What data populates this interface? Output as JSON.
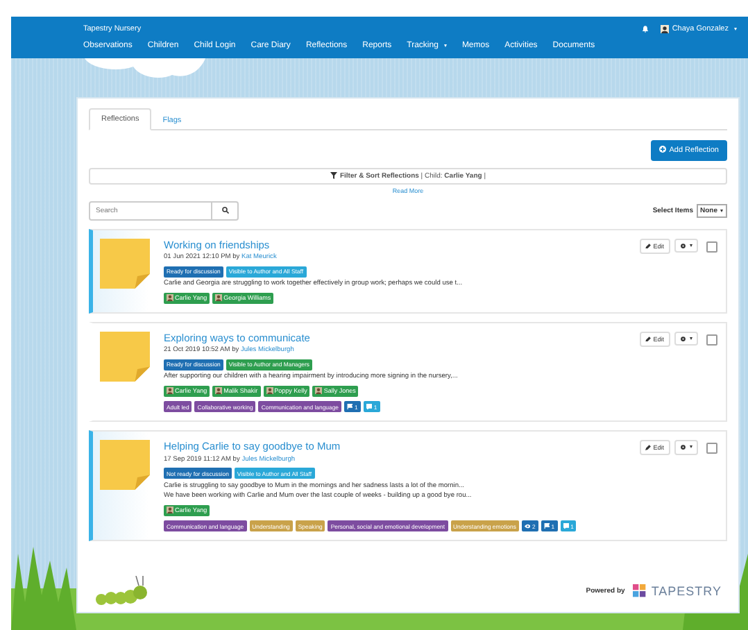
{
  "nav": {
    "brand": "Tapestry Nursery",
    "user": "Chaya Gonzalez",
    "items": [
      {
        "label": "Observations",
        "dropdown": false
      },
      {
        "label": "Children",
        "dropdown": false
      },
      {
        "label": "Child Login",
        "dropdown": false
      },
      {
        "label": "Care Diary",
        "dropdown": false
      },
      {
        "label": "Reflections",
        "dropdown": false
      },
      {
        "label": "Reports",
        "dropdown": false
      },
      {
        "label": "Tracking",
        "dropdown": true
      },
      {
        "label": "Memos",
        "dropdown": false
      },
      {
        "label": "Activities",
        "dropdown": false
      },
      {
        "label": "Documents",
        "dropdown": false
      }
    ]
  },
  "tabs": [
    {
      "label": "Reflections",
      "selected": true
    },
    {
      "label": "Flags",
      "selected": false
    }
  ],
  "add_button": "Add Reflection",
  "filter": "**Filter & Sort Reflections** | Child: **Carlie Yang** |",
  "read_more": "Read More",
  "search": {
    "placeholder": "Search"
  },
  "select_items": {
    "label": "Select Items",
    "value": "None"
  },
  "reflections": [
    {
      "title": "Working on friendships",
      "date": "01 Jun 2021 12:10 PM by",
      "author": "Kat Meurick",
      "highlighted": true,
      "statuses": [
        {
          "label": "Ready for discussion",
          "color": "#1f6fb2"
        },
        {
          "label": "Visible to Author and All Staff",
          "color": "#2aa8d8"
        }
      ],
      "excerpts": [
        "Carlie and Georgia are struggling to work together effectively in group work; perhaps we could use t..."
      ],
      "children": [
        "Carlie Yang",
        "Georgia Williams"
      ],
      "edit": "Edit"
    },
    {
      "title": "Exploring ways to communicate",
      "date": "21 Oct 2019 10:52 AM by",
      "author": "Jules Mickelburgh",
      "highlighted": false,
      "statuses": [
        {
          "label": "Ready for discussion",
          "color": "#1f6fb2"
        },
        {
          "label": "Visible to Author and Managers",
          "color": "#2e9e4f"
        }
      ],
      "excerpts": [
        "After supporting our children with a hearing impairment by introducing more signing in the nursery,..."
      ],
      "children": [
        "Carlie Yang",
        "Malik Shakir",
        "Poppy Kelly",
        "Sally Jones"
      ],
      "edit": "Edit",
      "tags": [
        {
          "label": "Adult led",
          "color": "#7d4ca0"
        },
        {
          "label": "Collaborative working",
          "color": "#7d4ca0"
        },
        {
          "label": "Communication and language",
          "color": "#7d4ca0"
        }
      ],
      "counters": [
        {
          "kind": "flag",
          "count": "1",
          "color": "#1f6fb2"
        },
        {
          "kind": "comment",
          "count": "1",
          "color": "#2aa8d8"
        }
      ]
    },
    {
      "title": "Helping Carlie to say goodbye to Mum",
      "date": "17 Sep 2019 11:12 AM by",
      "author": "Jules Mickelburgh",
      "highlighted": true,
      "statuses": [
        {
          "label": "Not ready for discussion",
          "color": "#1f6fb2"
        },
        {
          "label": "Visible to Author and All Staff",
          "color": "#2aa8d8"
        }
      ],
      "excerpts": [
        "Carlie is struggling to say goodbye to Mum in the mornings and her sadness lasts a lot of the mornin...",
        "We have been working with Carlie and Mum over the last couple of weeks - building up a good bye rou..."
      ],
      "children": [
        "Carlie Yang"
      ],
      "edit": "Edit",
      "tags": [
        {
          "label": "Communication and language",
          "color": "#7d4ca0"
        },
        {
          "label": "Understanding",
          "color": "#c9a24a"
        },
        {
          "label": "Speaking",
          "color": "#c9a24a"
        },
        {
          "label": "Personal, social and emotional development",
          "color": "#7d4ca0"
        },
        {
          "label": "Understanding emotions",
          "color": "#c9a24a"
        }
      ],
      "counters": [
        {
          "kind": "eye",
          "count": "2",
          "color": "#1f6fb2"
        },
        {
          "kind": "flag",
          "count": "1",
          "color": "#1f6fb2"
        },
        {
          "kind": "comment",
          "count": "1",
          "color": "#2aa8d8"
        }
      ]
    }
  ],
  "footer": {
    "powered": "Powered by",
    "logo": "TAPESTRY"
  }
}
